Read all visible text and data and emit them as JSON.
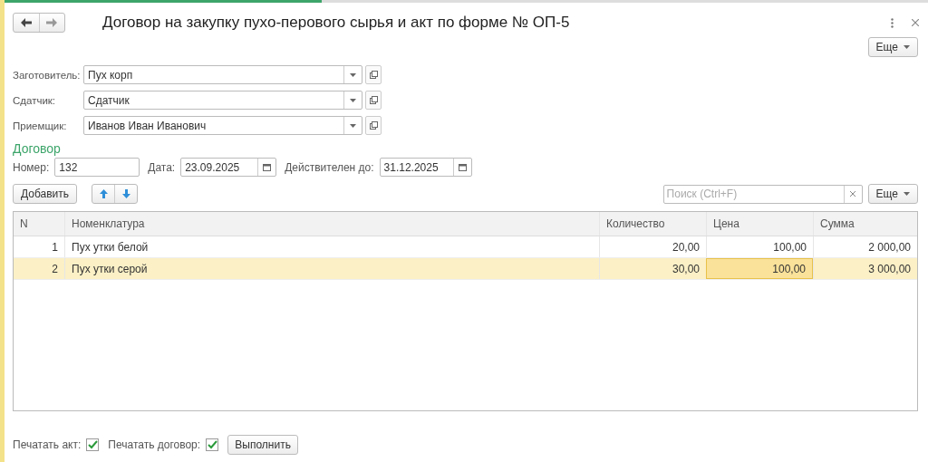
{
  "window": {
    "title": "Договор на закупку пухо-перового сырья и акт по форме № ОП-5"
  },
  "top_more": {
    "label": "Еще"
  },
  "fields": [
    {
      "label": "Заготовитель:",
      "value": "Пух корп"
    },
    {
      "label": "Сдатчик:",
      "value": "Сдатчик"
    },
    {
      "label": "Приемщик:",
      "value": "Иванов Иван Иванович"
    }
  ],
  "contract": {
    "heading": "Договор",
    "number_label": "Номер:",
    "number": "132",
    "date_label": "Дата:",
    "date": "23.09.2025",
    "valid_label": "Действителен до:",
    "valid_until": "31.12.2025"
  },
  "toolbar": {
    "add": "Добавить",
    "search_placeholder": "Поиск (Ctrl+F)",
    "more": "Еще"
  },
  "table": {
    "columns": [
      "N",
      "Номенклатура",
      "Количество",
      "Цена",
      "Сумма"
    ],
    "rows": [
      {
        "selected": false,
        "cells": [
          {
            "text": "1",
            "selected": false
          },
          {
            "text": "Пух утки белой",
            "selected": false
          },
          {
            "text": "20,00",
            "selected": false
          },
          {
            "text": "100,00",
            "selected": false
          },
          {
            "text": "2 000,00",
            "selected": false
          }
        ]
      },
      {
        "selected": true,
        "cells": [
          {
            "text": "2",
            "selected": false
          },
          {
            "text": "Пух утки серой",
            "selected": false
          },
          {
            "text": "30,00",
            "selected": false
          },
          {
            "text": "100,00",
            "selected": true
          },
          {
            "text": "3 000,00",
            "selected": false
          }
        ]
      }
    ]
  },
  "footer": {
    "print_act": {
      "label": "Печатать акт:",
      "checked": true
    },
    "print_contract": {
      "label": "Печатать договор:",
      "checked": true
    },
    "run": "Выполнить"
  }
}
